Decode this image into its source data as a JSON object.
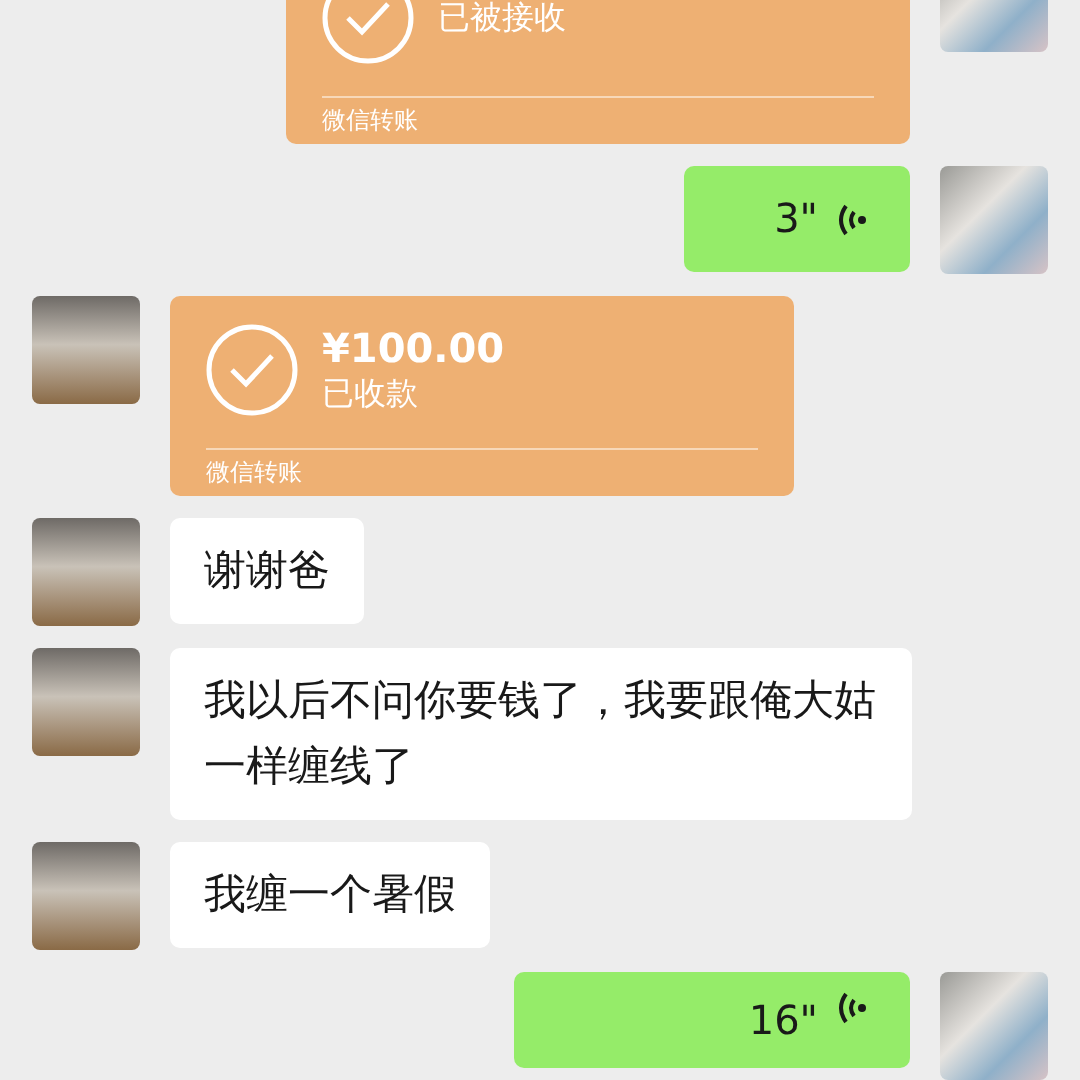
{
  "messages": [
    {
      "kind": "transfer",
      "sent": true,
      "status": "已被接收",
      "label": "微信转账"
    },
    {
      "kind": "voice",
      "sent": true,
      "duration": "3\""
    },
    {
      "kind": "transfer",
      "sent": false,
      "amount": "¥100.00",
      "status": "已收款",
      "label": "微信转账"
    },
    {
      "kind": "text",
      "sent": false,
      "text": "谢谢爸"
    },
    {
      "kind": "text",
      "sent": false,
      "text": "我以后不问你要钱了，我要跟俺大姑一样缠线了"
    },
    {
      "kind": "text",
      "sent": false,
      "text": "我缠一个暑假"
    },
    {
      "kind": "voice",
      "sent": true,
      "duration": "16\""
    }
  ]
}
